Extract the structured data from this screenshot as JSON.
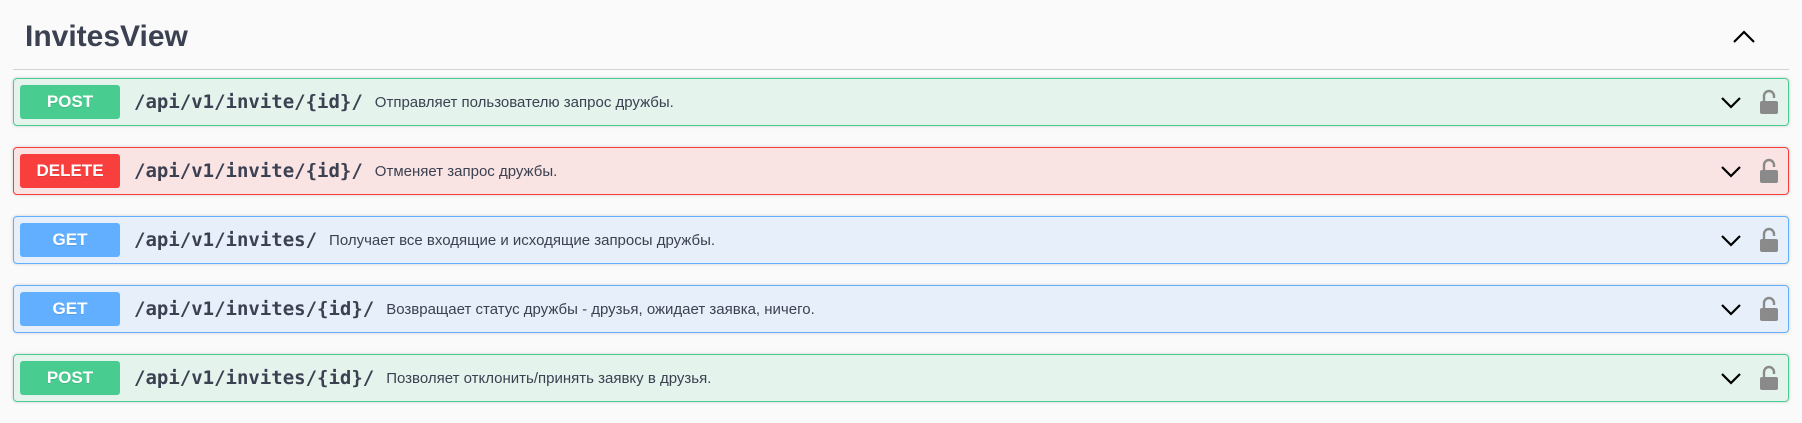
{
  "section": {
    "title": "InvitesView",
    "collapse_icon": "chevron-up-icon"
  },
  "operations": [
    {
      "method": "POST",
      "path": "/api/v1/invite/{id}/",
      "description": "Отправляет пользователю запрос дружбы.",
      "color": "#49cc90"
    },
    {
      "method": "DELETE",
      "path": "/api/v1/invite/{id}/",
      "description": "Отменяет запрос дружбы.",
      "color": "#f93e3e"
    },
    {
      "method": "GET",
      "path": "/api/v1/invites/",
      "description": "Получает все входящие и исходящие запросы дружбы.",
      "color": "#61affe"
    },
    {
      "method": "GET",
      "path": "/api/v1/invites/{id}/",
      "description": "Возвращает статус дружбы - друзья, ожидает заявка, ничего.",
      "color": "#61affe"
    },
    {
      "method": "POST",
      "path": "/api/v1/invites/{id}/",
      "description": "Позволяет отклонить/принять заявку в друзья.",
      "color": "#49cc90"
    }
  ],
  "icons": {
    "expand": "chevron-down-icon",
    "auth": "unlocked-lock-icon"
  }
}
